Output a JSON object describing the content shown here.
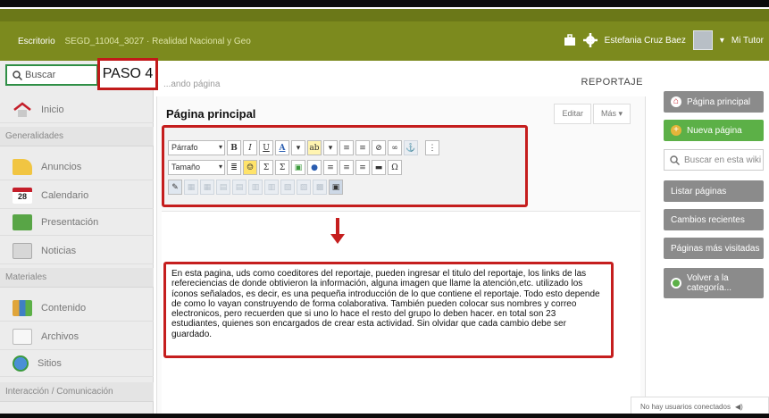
{
  "topbar": {
    "home_label": "Escritorio",
    "course_label": "SEGD_11004_3027 · Realidad Nacional y Geo",
    "user_name": "Estefania Cruz Baez",
    "tutor_label": "Mi Tutor",
    "bar_color": "#7c8a1e"
  },
  "callout": {
    "label": "PASO 4"
  },
  "sidebar": {
    "search_placeholder": "Buscar",
    "items": [
      {
        "label": "Inicio",
        "icon": "home-icon"
      },
      {
        "label": "Generalidades",
        "section": true
      },
      {
        "label": "Anuncios",
        "icon": "megaphone-icon"
      },
      {
        "label": "Calendario",
        "icon": "calendar-icon",
        "icon_text": "28"
      },
      {
        "label": "Presentación",
        "icon": "presentation-icon"
      },
      {
        "label": "Noticias",
        "icon": "news-icon"
      },
      {
        "label": "Materiales",
        "section": true
      },
      {
        "label": "Contenido",
        "icon": "content-icon"
      },
      {
        "label": "Archivos",
        "icon": "files-icon"
      },
      {
        "label": "Sitios",
        "icon": "globe-icon"
      },
      {
        "label": "Interacción / Comunicación",
        "section": true
      }
    ]
  },
  "main": {
    "breadcrumb": "...ando página",
    "section_title": "REPORTAJE",
    "page_title": "Página principal",
    "tabs": {
      "edit": "Editar",
      "more": "Más"
    },
    "toolbar": {
      "format_select": "Párrafo",
      "size_select": "Tamaño",
      "bold": "B",
      "italic": "I",
      "underline": "U",
      "omega": "Ω",
      "sigma": "Σ"
    },
    "note": "En esta pagina, uds como coeditores del reportaje, pueden ingresar el titulo del reportaje, los links de las refereciencias de donde obtivieron la información, alguna imagen que llame la atención,etc. utilizado los íconos señalados, es decir, es una pequeña introducción de lo que contiene el reportaje. Todo esto depende de como lo vayan construyendo de forma colaborativa. También pueden colocar sus nombres y correo electronicos, pero recuerden que si uno lo hace el resto del grupo lo deben hacer. en total son 23 estudiantes, quienes son encargados de crear esta actividad. Sin olvidar que cada cambio debe ser guardado."
  },
  "right_panel": {
    "home_button": "Página principal",
    "new_page_button": "Nueva página",
    "search_placeholder": "Buscar en esta wiki",
    "list_pages": "Listar páginas",
    "recent_changes": "Cambios recientes",
    "most_visited": "Páginas más visitadas",
    "back_button": "Volver a la categoría..."
  },
  "status": {
    "connected": "No hay usuarios conectados"
  },
  "colors": {
    "highlight": "#c51e1e",
    "green": "#5cb047",
    "gray": "#8b8b8b"
  }
}
